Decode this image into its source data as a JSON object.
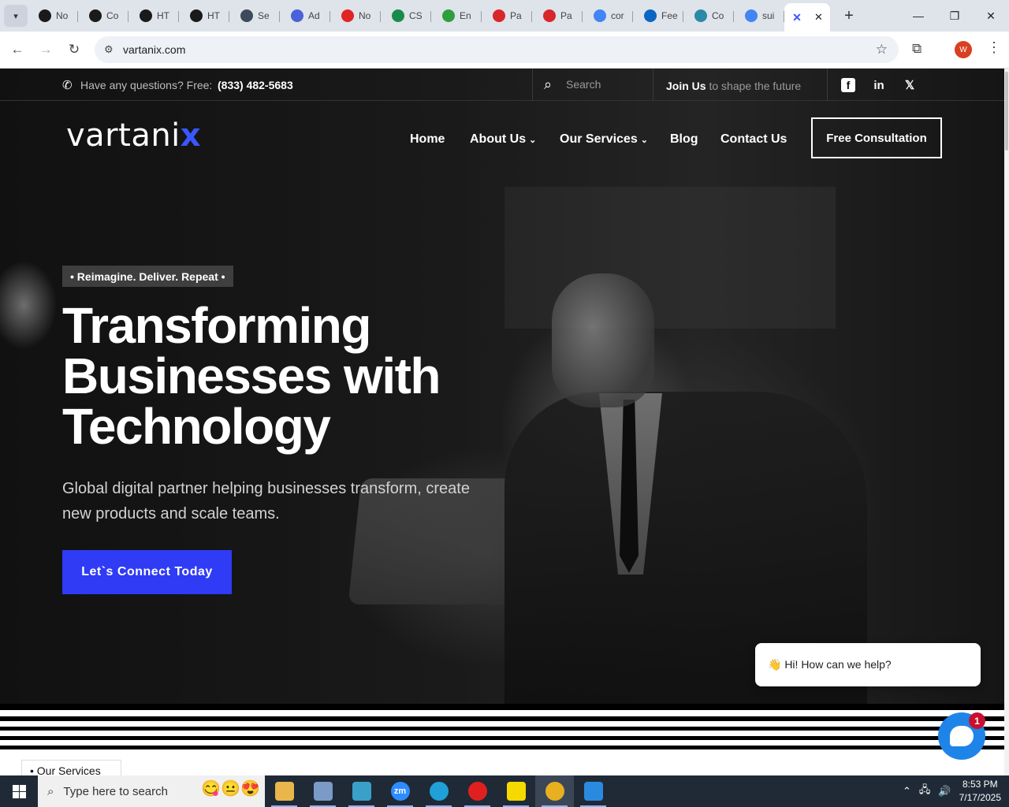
{
  "browser": {
    "tabs": [
      {
        "label": "No",
        "icon": "openai-icon",
        "color": "#1a1a1a"
      },
      {
        "label": "Co",
        "icon": "openai-icon",
        "color": "#1a1a1a"
      },
      {
        "label": "HT",
        "icon": "openai-icon",
        "color": "#1a1a1a"
      },
      {
        "label": "HT",
        "icon": "openai-icon",
        "color": "#1a1a1a"
      },
      {
        "label": "Se",
        "icon": "wordpress-icon",
        "color": "#3c4a5a"
      },
      {
        "label": "Ad",
        "icon": "app-icon",
        "color": "#4a62d8"
      },
      {
        "label": "No",
        "icon": "youtube-icon",
        "color": "#e02424"
      },
      {
        "label": "CS",
        "icon": "w-icon",
        "color": "#1a8a4a"
      },
      {
        "label": "En",
        "icon": "evernote-icon",
        "color": "#2e9e3e"
      },
      {
        "label": "Pa",
        "icon": "pdf-icon",
        "color": "#d8262a"
      },
      {
        "label": "Pa",
        "icon": "pdf-icon",
        "color": "#d8262a"
      },
      {
        "label": "cor",
        "icon": "google-icon",
        "color": "#4285f4"
      },
      {
        "label": "Fee",
        "icon": "linkedin-icon",
        "color": "#0a66c2"
      },
      {
        "label": "Co",
        "icon": "app-icon",
        "color": "#2a8aa8"
      },
      {
        "label": "sui",
        "icon": "google-icon",
        "color": "#4285f4"
      }
    ],
    "active_tab_icon": "vartanix-icon",
    "url": "vartanix.com",
    "profile_initial": "W"
  },
  "topbar": {
    "question": "Have any questions? Free:",
    "phone": "(833) 482-5683",
    "search_placeholder": "Search",
    "join_bold": "Join Us",
    "join_rest": " to shape the future",
    "social": [
      "facebook-icon",
      "linkedin-icon",
      "x-icon"
    ]
  },
  "brand": {
    "logo_main": "vartani",
    "logo_x": "x"
  },
  "nav": {
    "home": "Home",
    "about": "About Us",
    "services": "Our Services",
    "blog": "Blog",
    "contact": "Contact Us",
    "consult": "Free Consultation"
  },
  "hero": {
    "tagline": "• Reimagine. Deliver. Repeat •",
    "headline_1": "Transforming",
    "headline_2": "Businesses with",
    "headline_3": "Technology",
    "subtext": "Global digital partner helping businesses transform, create new products and scale teams.",
    "cta": "Let`s Connect Today"
  },
  "section": {
    "chip": "• Our Services"
  },
  "chat": {
    "greeting": "👋 Hi! How can we help?",
    "badge": "1"
  },
  "taskbar": {
    "search_placeholder": "Type here to search",
    "apps": [
      {
        "name": "file-explorer-icon",
        "color": "#e8b64a",
        "label": ""
      },
      {
        "name": "paint-icon",
        "color": "#7a9ac8",
        "label": ""
      },
      {
        "name": "app-icon",
        "color": "#3aa0c8",
        "label": ""
      },
      {
        "name": "zoom-icon",
        "color": "#2d8cff",
        "label": "zm"
      },
      {
        "name": "edge-icon",
        "color": "#1fa0d8",
        "label": ""
      },
      {
        "name": "opera-icon",
        "color": "#e0201f",
        "label": ""
      },
      {
        "name": "sticky-notes-icon",
        "color": "#f5d900",
        "label": ""
      },
      {
        "name": "chrome-icon",
        "color": "#e8b020",
        "label": ""
      },
      {
        "name": "vscode-icon",
        "color": "#2a8ae0",
        "label": ""
      }
    ],
    "time": "8:53 PM",
    "date": "7/17/2025"
  },
  "colors": {
    "accent": "#2f3bf5",
    "logo_x": "#3a56ff",
    "chat": "#1f84e8"
  }
}
